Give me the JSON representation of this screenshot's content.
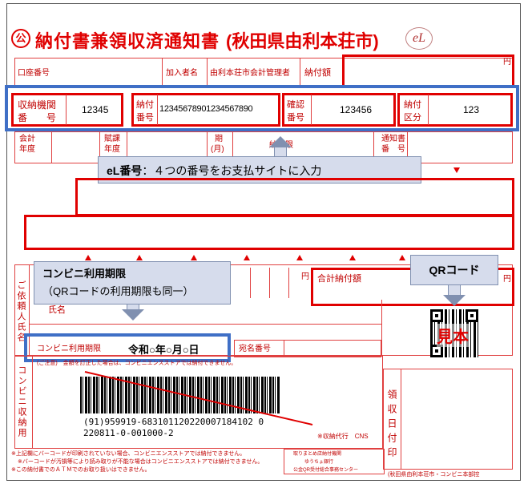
{
  "header": {
    "logo_char": "公",
    "title": "納付書兼領収済通知書",
    "city": "(秋田県由利本荘市)",
    "el_logo": "eL"
  },
  "row1": {
    "account_no": "口座番号",
    "subscriber": "加入者名",
    "subscriber_name": "由利本荘市会計管理者",
    "amount_label": "納付額",
    "yen": "円"
  },
  "row2": {
    "inst_no_label_1": "収納機関",
    "inst_no_label_2": "番　　号",
    "inst_no": "12345",
    "pay_no_label_1": "納付",
    "pay_no_label_2": "番号",
    "pay_no": "12345678901234567890",
    "confirm_label_1": "確認",
    "confirm_label_2": "番号",
    "confirm_no": "123456",
    "class_label_1": "納付",
    "class_label_2": "区分",
    "class_no": "123"
  },
  "row3": {
    "fiscal_1": "会計",
    "fiscal_2": "年度",
    "tax_1": "賦課",
    "tax_2": "年度",
    "term_1": "期",
    "term_2": "(月)",
    "due": "納期限",
    "notice_1": "通知書",
    "notice_2": "番　号"
  },
  "callout_el": {
    "bold": "eL番号",
    "text": "：４つの番号をお支払サイトに入力"
  },
  "callout_conv": {
    "line1": "コンビニ利用期限",
    "line2": "（QRコードの利用期限も同一）"
  },
  "callout_qr": {
    "text": "QRコード"
  },
  "middle": {
    "yen": "円",
    "total_label": "合計納付額",
    "yen2": "円"
  },
  "payer": {
    "vertical": "ご依頼人氏名",
    "name_label": "氏名"
  },
  "conv": {
    "label": "コンビニ利用期限",
    "date": "令和○年○月○日",
    "dest_label": "宛名番号"
  },
  "barcode": {
    "vertical": "コンビニ収納用",
    "note": "(ご注意)　金額を訂正した場合は、コンビニエンスストアでは納付できません。",
    "line1": "(91)959919-683101120220007184102 0",
    "line2": "220811-0-001000-2",
    "agent": "※収納代行　CNS"
  },
  "qr": {
    "stamp": "見本"
  },
  "receipt": {
    "vertical": "領収日付印"
  },
  "footer": {
    "note1": "※上記欄にバーコードが印刷されていない場合、コンビニエンスストアでは納付できません。",
    "note2": "※バーコードが汚損等により読み取りが不能な場合はコンビニエンスストアでは納付できません。",
    "note3": "※この納付書でのＡＴＭでのお取り扱いはできません。",
    "bank1": "取りまとめ店納付機関",
    "bank2": "ゆうちょ銀行",
    "bank3": "公金QR受付総合事務センター",
    "issuer": "(秋田県由利本荘市・コンビニ本部控"
  },
  "colors": {
    "red": "#e00000",
    "blue": "#3f6fc6",
    "callout_bg": "#d6dcec"
  }
}
